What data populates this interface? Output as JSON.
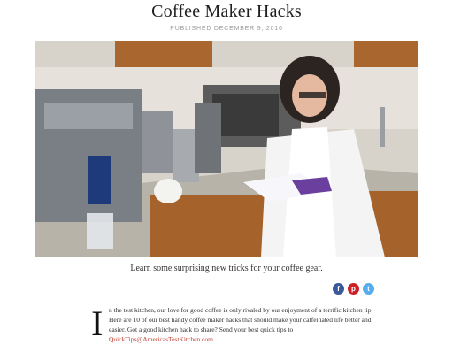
{
  "article": {
    "title": "Coffee Maker Hacks",
    "published": "PUBLISHED DECEMBER 9, 2016",
    "caption": "Learn some surprising new tricks for your coffee gear.",
    "dropcap": "I",
    "body_text": "n the test kitchen, our love for good coffee is only rivaled by our enjoyment of a terrific kitchen tip. Here are 10 of our best handy coffee maker hacks that should make your caffeinated life better and easier. Got a good kitchen hack to share? Send your best quick tips to",
    "email_link": "QuickTips@AmericasTestKitchen.com",
    "email_suffix": "."
  },
  "social": {
    "facebook_icon": "f",
    "pinterest_icon": "p",
    "twitter_icon": "t",
    "colors": {
      "facebook": "#3b5998",
      "pinterest": "#cb2027",
      "twitter": "#55acee"
    }
  },
  "link_color": "#c0392b"
}
